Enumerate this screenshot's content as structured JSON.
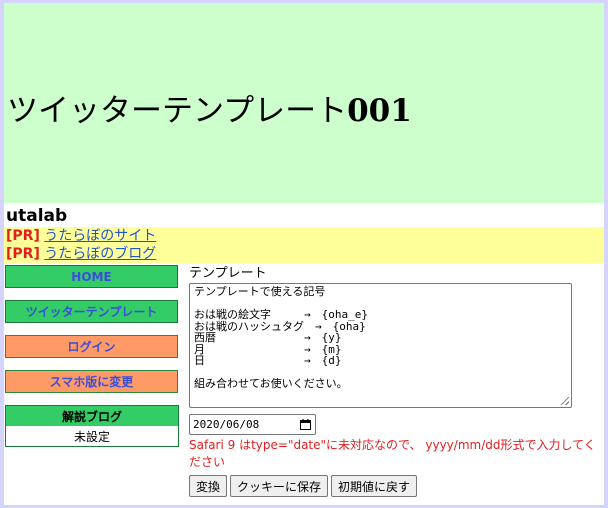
{
  "header": {
    "title_text": "ツイッターテンプレート",
    "title_number": "001"
  },
  "site": {
    "name": "utalab"
  },
  "pr": [
    {
      "tag": "[PR]",
      "link": "うたらぼのサイト"
    },
    {
      "tag": "[PR]",
      "link": "うたらぼのブログ"
    }
  ],
  "sidebar": {
    "home": "HOME",
    "twitter_template": "ツイッターテンプレート",
    "login": "ログイン",
    "smartphone": "スマホ版に変更",
    "blog_title": "解説ブログ",
    "blog_value": "未設定"
  },
  "main": {
    "template_label": "テンプレート",
    "template_lines": [
      "テンプレートで使える記号",
      "",
      "おは戦の絵文字　　　→　{oha_e}",
      "おは戦のハッシュタグ　→　{oha}",
      "西暦　　　　　　　　→　{y}",
      "月　　　　　　　　　→　{m}",
      "日　　　　　　　　　→　{d}",
      "",
      "組み合わせてお使いください。"
    ],
    "date_value": "2020/06/08",
    "notice": "Safari 9 はtype=\"date\"に未対応なので、 yyyy/mm/dd形式で入力してください",
    "buttons": {
      "convert": "変換",
      "save_cookie": "クッキーに保存",
      "reset": "初期値に戻す"
    }
  },
  "colors": {
    "banner_bg": "#ccffcc",
    "pr_bg": "#ffff99",
    "green_button": "#33cc66",
    "orange_button": "#ff9966",
    "notice_red": "#e02020",
    "link_blue": "#2255cc"
  }
}
